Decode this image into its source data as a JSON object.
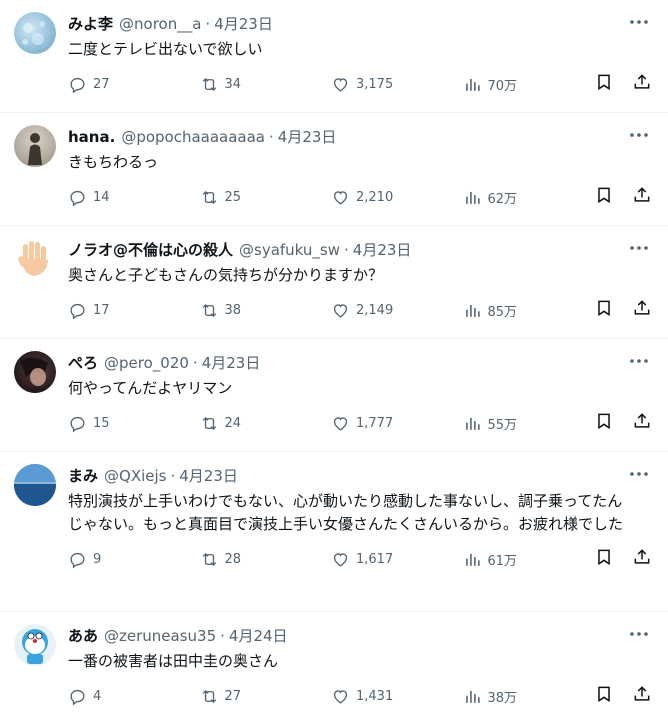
{
  "tweets": [
    {
      "display_name": "みよ李",
      "handle": "@noron__a",
      "date": "4月23日",
      "text": "二度とテレビ出ないで欲しい",
      "replies": "27",
      "reposts": "34",
      "likes": "3,175",
      "views": "70万"
    },
    {
      "display_name": "hana.",
      "handle": "@popochaaaaaaaa",
      "date": "4月23日",
      "text": "きもちわるっ",
      "replies": "14",
      "reposts": "25",
      "likes": "2,210",
      "views": "62万"
    },
    {
      "display_name": "ノラオ@不倫は心の殺人",
      "handle": "@syafuku_sw",
      "date": "4月23日",
      "text": "奥さんと子どもさんの気持ちが分かりますか？",
      "replies": "17",
      "reposts": "38",
      "likes": "2,149",
      "views": "85万"
    },
    {
      "display_name": "ぺろ",
      "handle": "@pero_020",
      "date": "4月23日",
      "text": "何やってんだよヤリマン",
      "replies": "15",
      "reposts": "24",
      "likes": "1,777",
      "views": "55万"
    },
    {
      "display_name": "まみ",
      "handle": "@QXiejs",
      "date": "4月23日",
      "text": "特別演技が上手いわけでもない、心が動いたり感動した事ないし、調子乗ってたんじゃない。もっと真面目で演技上手い女優さんたくさんいるから。お疲れ様でした",
      "replies": "9",
      "reposts": "28",
      "likes": "1,617",
      "views": "61万"
    },
    {
      "display_name": "ああ",
      "handle": "@zeruneasu35",
      "date": "4月24日",
      "text": "一番の被害者は田中圭の奥さん",
      "replies": "4",
      "reposts": "27",
      "likes": "1,431",
      "views": "38万"
    }
  ],
  "separator": "·",
  "icons": {
    "more": "more-dots-icon",
    "reply": "reply-icon",
    "repost": "repost-icon",
    "like": "heart-icon",
    "views": "views-icon",
    "bookmark": "bookmark-icon",
    "share": "share-icon"
  },
  "colors": {
    "text": "#0f1419",
    "secondary": "#536471",
    "divider": "#eff3f4"
  }
}
